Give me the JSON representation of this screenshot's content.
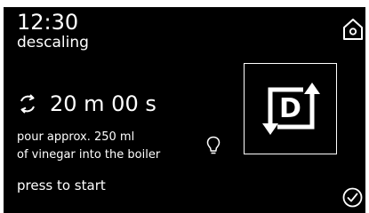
{
  "status": {
    "time": "12:30",
    "mode": "descaling"
  },
  "timer": {
    "value": "20 m 00 s",
    "icon": "cycle-arrows-icon"
  },
  "instructions": {
    "line1": "pour approx. 250 ml",
    "line2": "of vinegar into the boiler"
  },
  "prompt": {
    "label": "press to start"
  },
  "descale_symbol": {
    "letter": "D",
    "icon": "descale-cycle-icon"
  },
  "icons": {
    "home": "home-icon",
    "tip": "lightbulb-icon",
    "confirm": "checkmark-icon"
  },
  "colors": {
    "background": "#000000",
    "foreground": "#ffffff"
  }
}
